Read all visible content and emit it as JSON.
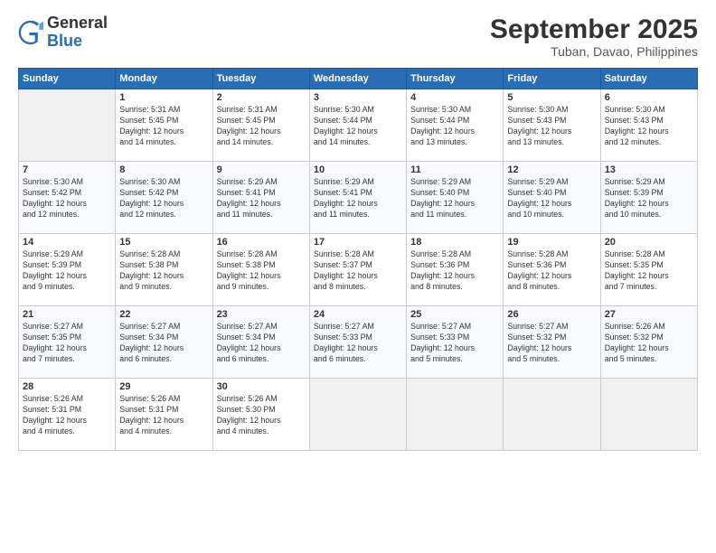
{
  "header": {
    "logo_general": "General",
    "logo_blue": "Blue",
    "title": "September 2025",
    "subtitle": "Tuban, Davao, Philippines"
  },
  "days_of_week": [
    "Sunday",
    "Monday",
    "Tuesday",
    "Wednesday",
    "Thursday",
    "Friday",
    "Saturday"
  ],
  "weeks": [
    [
      {
        "day": "",
        "info": ""
      },
      {
        "day": "1",
        "info": "Sunrise: 5:31 AM\nSunset: 5:45 PM\nDaylight: 12 hours\nand 14 minutes."
      },
      {
        "day": "2",
        "info": "Sunrise: 5:31 AM\nSunset: 5:45 PM\nDaylight: 12 hours\nand 14 minutes."
      },
      {
        "day": "3",
        "info": "Sunrise: 5:30 AM\nSunset: 5:44 PM\nDaylight: 12 hours\nand 14 minutes."
      },
      {
        "day": "4",
        "info": "Sunrise: 5:30 AM\nSunset: 5:44 PM\nDaylight: 12 hours\nand 13 minutes."
      },
      {
        "day": "5",
        "info": "Sunrise: 5:30 AM\nSunset: 5:43 PM\nDaylight: 12 hours\nand 13 minutes."
      },
      {
        "day": "6",
        "info": "Sunrise: 5:30 AM\nSunset: 5:43 PM\nDaylight: 12 hours\nand 12 minutes."
      }
    ],
    [
      {
        "day": "7",
        "info": "Sunrise: 5:30 AM\nSunset: 5:42 PM\nDaylight: 12 hours\nand 12 minutes."
      },
      {
        "day": "8",
        "info": "Sunrise: 5:30 AM\nSunset: 5:42 PM\nDaylight: 12 hours\nand 12 minutes."
      },
      {
        "day": "9",
        "info": "Sunrise: 5:29 AM\nSunset: 5:41 PM\nDaylight: 12 hours\nand 11 minutes."
      },
      {
        "day": "10",
        "info": "Sunrise: 5:29 AM\nSunset: 5:41 PM\nDaylight: 12 hours\nand 11 minutes."
      },
      {
        "day": "11",
        "info": "Sunrise: 5:29 AM\nSunset: 5:40 PM\nDaylight: 12 hours\nand 11 minutes."
      },
      {
        "day": "12",
        "info": "Sunrise: 5:29 AM\nSunset: 5:40 PM\nDaylight: 12 hours\nand 10 minutes."
      },
      {
        "day": "13",
        "info": "Sunrise: 5:29 AM\nSunset: 5:39 PM\nDaylight: 12 hours\nand 10 minutes."
      }
    ],
    [
      {
        "day": "14",
        "info": "Sunrise: 5:29 AM\nSunset: 5:39 PM\nDaylight: 12 hours\nand 9 minutes."
      },
      {
        "day": "15",
        "info": "Sunrise: 5:28 AM\nSunset: 5:38 PM\nDaylight: 12 hours\nand 9 minutes."
      },
      {
        "day": "16",
        "info": "Sunrise: 5:28 AM\nSunset: 5:38 PM\nDaylight: 12 hours\nand 9 minutes."
      },
      {
        "day": "17",
        "info": "Sunrise: 5:28 AM\nSunset: 5:37 PM\nDaylight: 12 hours\nand 8 minutes."
      },
      {
        "day": "18",
        "info": "Sunrise: 5:28 AM\nSunset: 5:36 PM\nDaylight: 12 hours\nand 8 minutes."
      },
      {
        "day": "19",
        "info": "Sunrise: 5:28 AM\nSunset: 5:36 PM\nDaylight: 12 hours\nand 8 minutes."
      },
      {
        "day": "20",
        "info": "Sunrise: 5:28 AM\nSunset: 5:35 PM\nDaylight: 12 hours\nand 7 minutes."
      }
    ],
    [
      {
        "day": "21",
        "info": "Sunrise: 5:27 AM\nSunset: 5:35 PM\nDaylight: 12 hours\nand 7 minutes."
      },
      {
        "day": "22",
        "info": "Sunrise: 5:27 AM\nSunset: 5:34 PM\nDaylight: 12 hours\nand 6 minutes."
      },
      {
        "day": "23",
        "info": "Sunrise: 5:27 AM\nSunset: 5:34 PM\nDaylight: 12 hours\nand 6 minutes."
      },
      {
        "day": "24",
        "info": "Sunrise: 5:27 AM\nSunset: 5:33 PM\nDaylight: 12 hours\nand 6 minutes."
      },
      {
        "day": "25",
        "info": "Sunrise: 5:27 AM\nSunset: 5:33 PM\nDaylight: 12 hours\nand 5 minutes."
      },
      {
        "day": "26",
        "info": "Sunrise: 5:27 AM\nSunset: 5:32 PM\nDaylight: 12 hours\nand 5 minutes."
      },
      {
        "day": "27",
        "info": "Sunrise: 5:26 AM\nSunset: 5:32 PM\nDaylight: 12 hours\nand 5 minutes."
      }
    ],
    [
      {
        "day": "28",
        "info": "Sunrise: 5:26 AM\nSunset: 5:31 PM\nDaylight: 12 hours\nand 4 minutes."
      },
      {
        "day": "29",
        "info": "Sunrise: 5:26 AM\nSunset: 5:31 PM\nDaylight: 12 hours\nand 4 minutes."
      },
      {
        "day": "30",
        "info": "Sunrise: 5:26 AM\nSunset: 5:30 PM\nDaylight: 12 hours\nand 4 minutes."
      },
      {
        "day": "",
        "info": ""
      },
      {
        "day": "",
        "info": ""
      },
      {
        "day": "",
        "info": ""
      },
      {
        "day": "",
        "info": ""
      }
    ]
  ]
}
